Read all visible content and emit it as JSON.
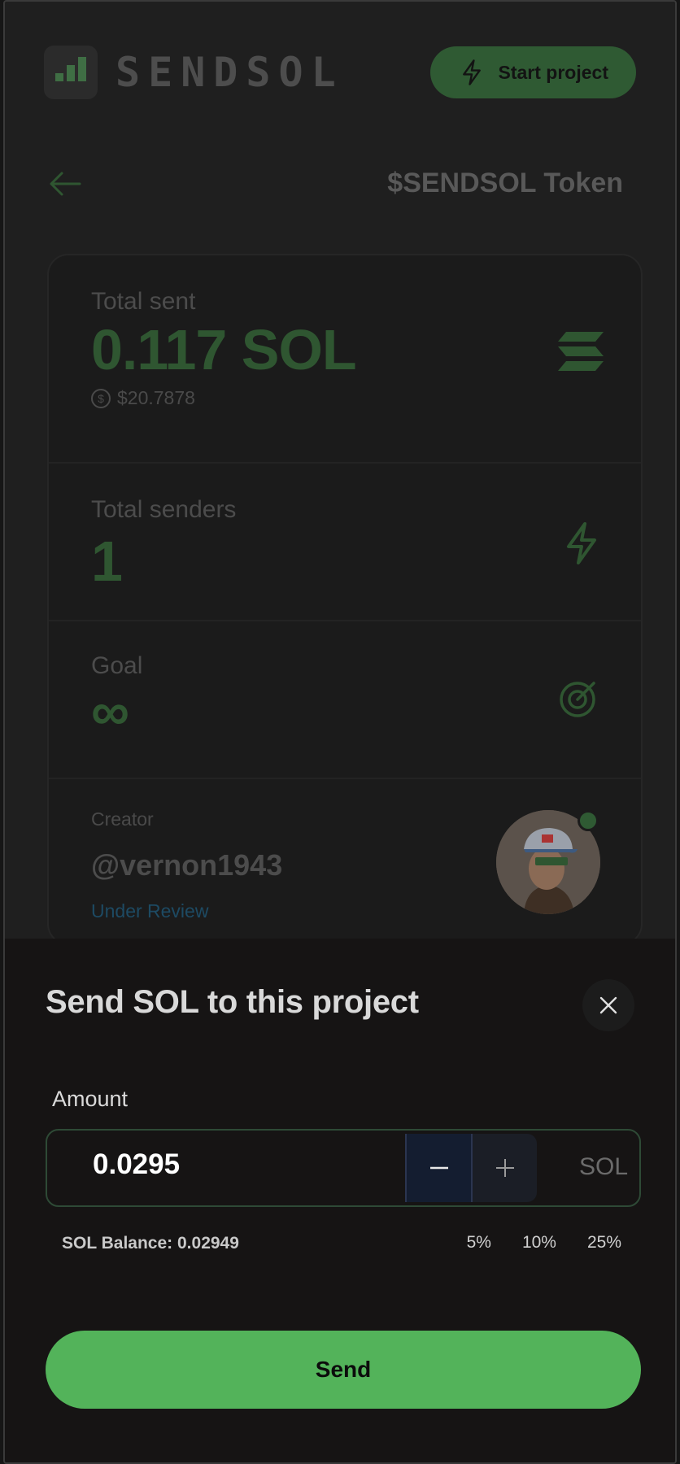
{
  "header": {
    "brand": "SENDSOL",
    "start_project_label": "Start project"
  },
  "project": {
    "title": "$SENDSOL Token"
  },
  "stats": {
    "total_sent_label": "Total sent",
    "total_sent_value": "0.117 SOL",
    "total_sent_usd": "$20.7878",
    "total_senders_label": "Total senders",
    "total_senders_value": "1",
    "goal_label": "Goal",
    "goal_value": "∞",
    "creator_label": "Creator",
    "creator_handle": "@vernon1943",
    "creator_status": "Under Review"
  },
  "sheet": {
    "title": "Send SOL to this project",
    "amount_label": "Amount",
    "amount_value": "0.0295",
    "unit": "SOL",
    "balance_text": "SOL Balance: 0.02949",
    "percent_options": [
      "5%",
      "10%",
      "25%"
    ],
    "send_label": "Send"
  },
  "colors": {
    "accent": "#53b35a",
    "dim_accent": "#2f5631",
    "background": "#1f1f1f",
    "sheet_background": "#161414",
    "status_link": "#1d4a63"
  }
}
